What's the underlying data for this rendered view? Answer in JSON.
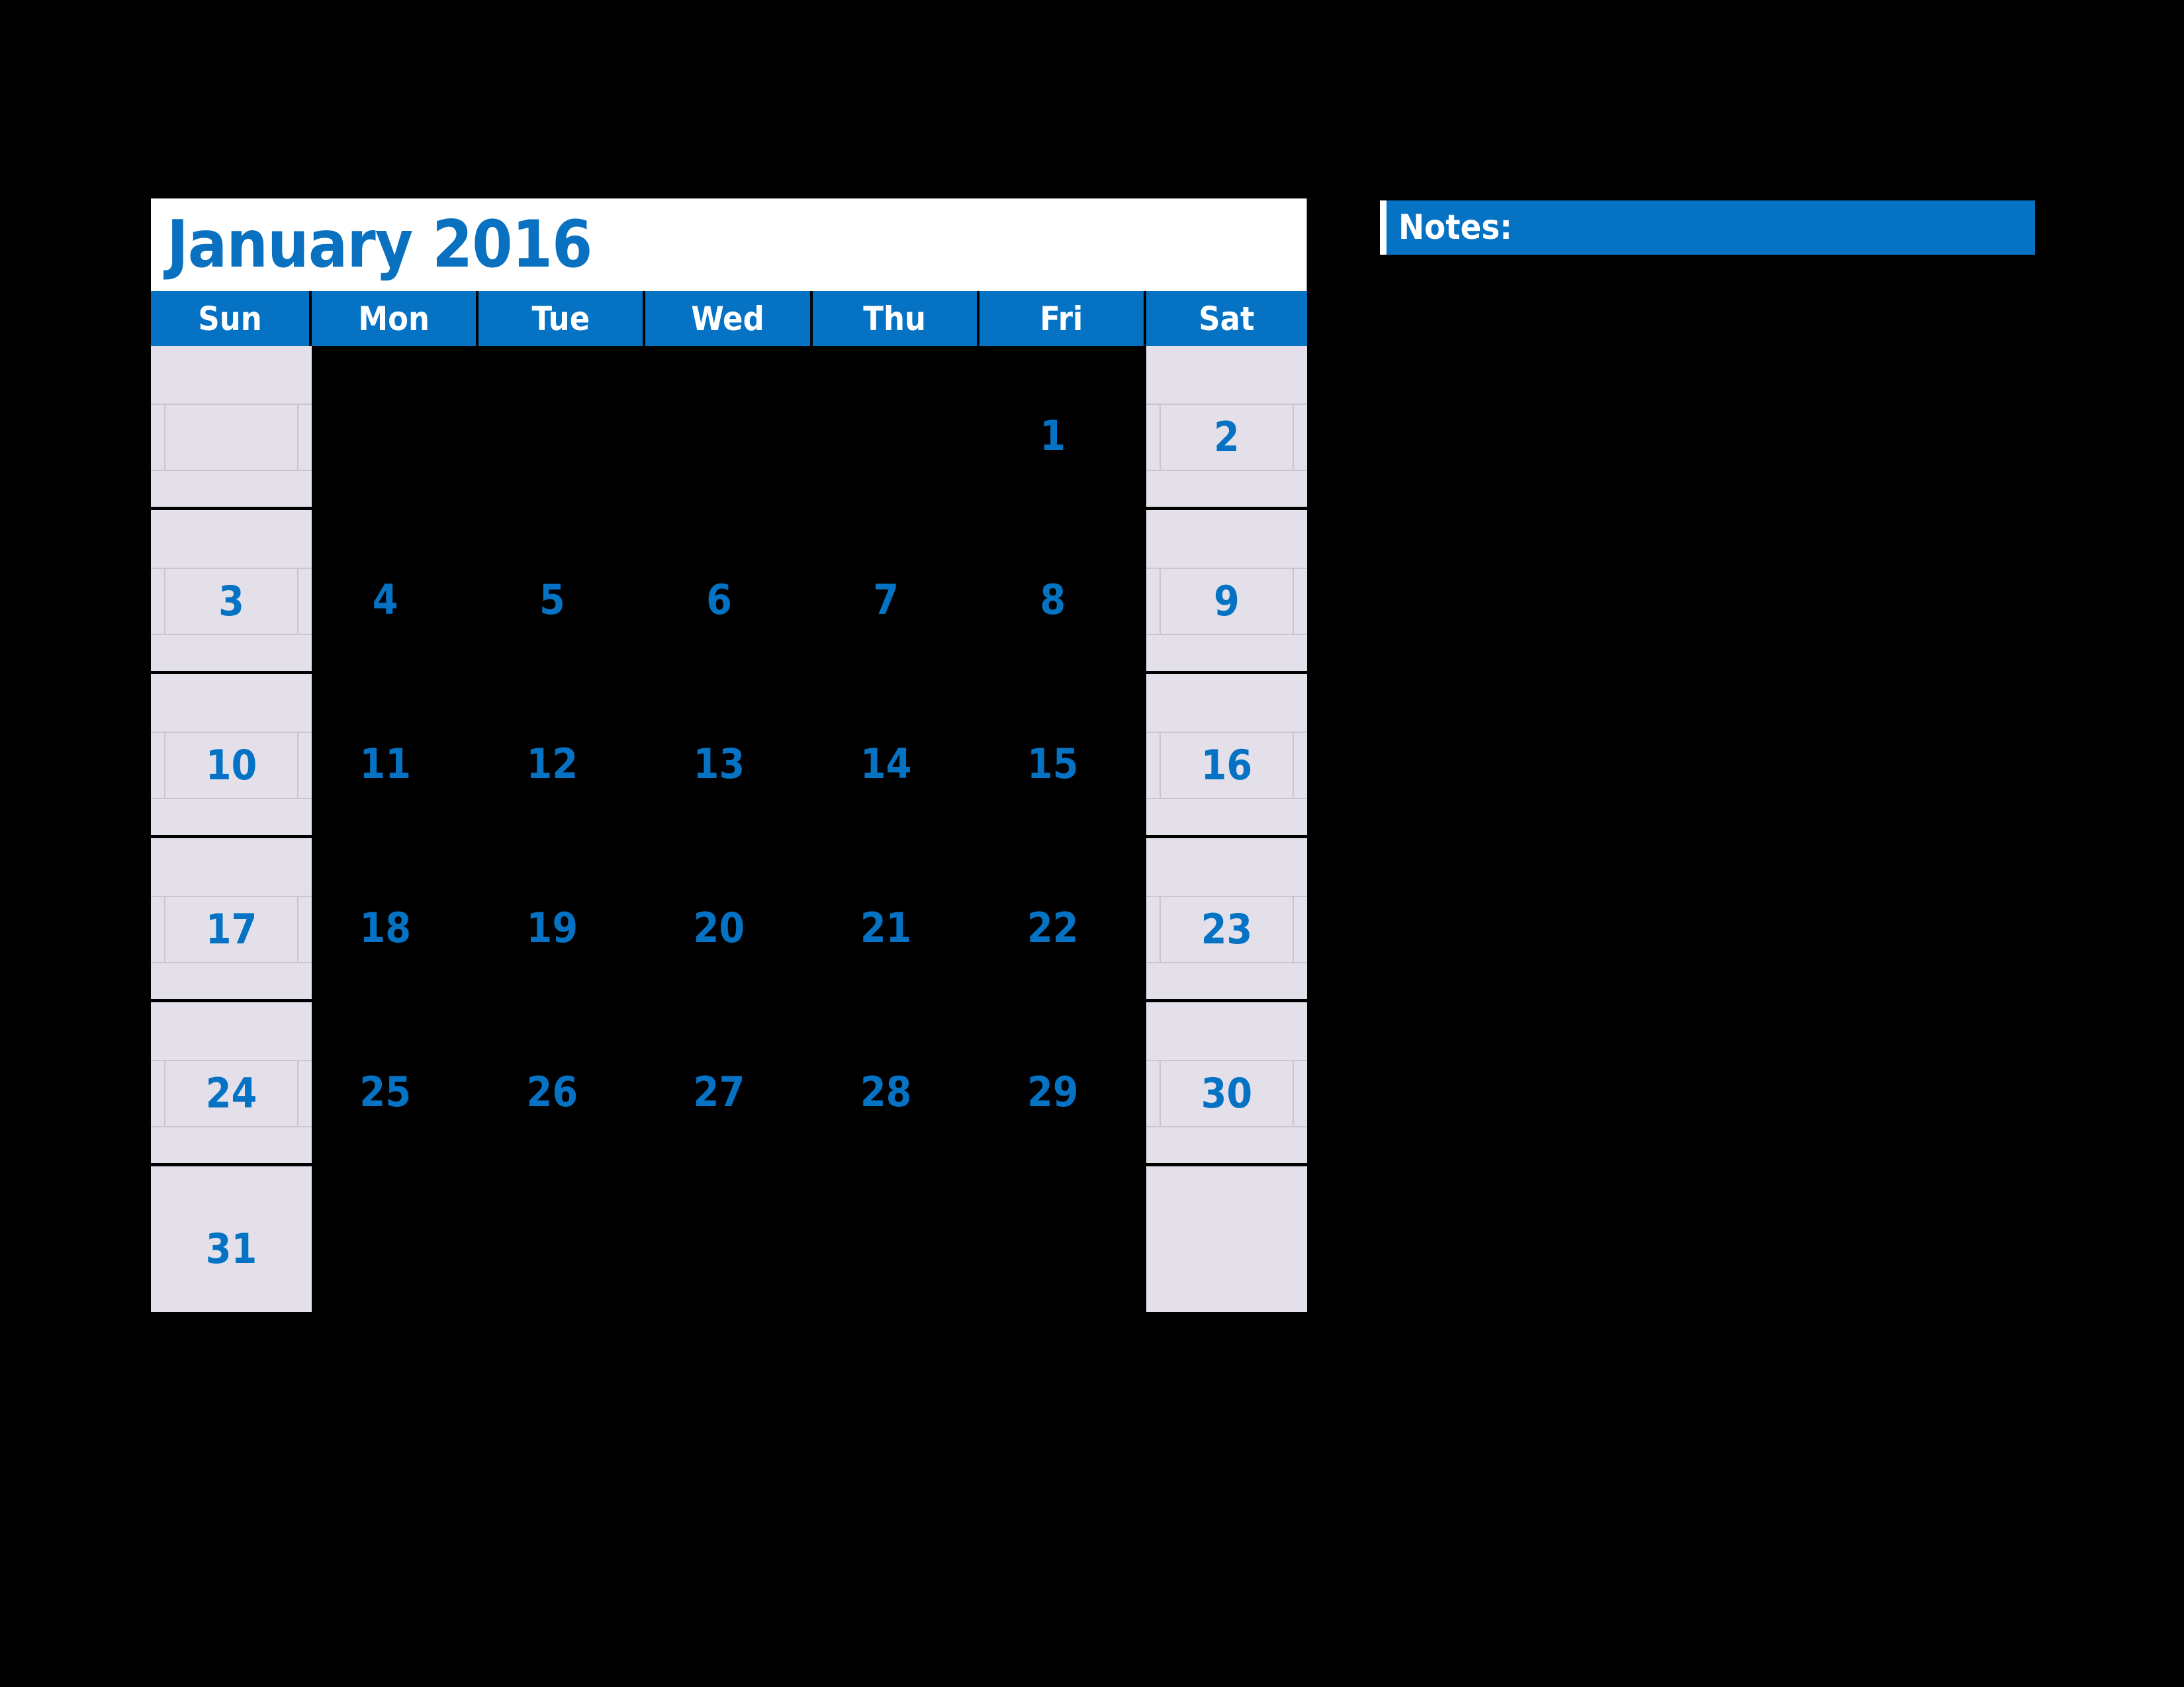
{
  "calendar": {
    "title": "January 2016",
    "month": "January",
    "year": "2016",
    "accent_color": "#0572c4",
    "weekend_cell_color": "#e3e0ea",
    "title_bar_color": "#ffffff",
    "page_background": "#000000",
    "day_headers": [
      {
        "label": "Sun",
        "type": "weekend"
      },
      {
        "label": "Mon",
        "type": "weekday"
      },
      {
        "label": "Tue",
        "type": "weekday"
      },
      {
        "label": "Wed",
        "type": "weekday"
      },
      {
        "label": "Thu",
        "type": "weekday"
      },
      {
        "label": "Fri",
        "type": "weekday"
      },
      {
        "label": "Sat",
        "type": "weekend"
      }
    ],
    "weeks": [
      {
        "days": [
          "",
          "",
          "",
          "",
          "",
          "1",
          "2"
        ]
      },
      {
        "days": [
          "3",
          "4",
          "5",
          "6",
          "7",
          "8",
          "9"
        ]
      },
      {
        "days": [
          "10",
          "11",
          "12",
          "13",
          "14",
          "15",
          "16"
        ]
      },
      {
        "days": [
          "17",
          "18",
          "19",
          "20",
          "21",
          "22",
          "23"
        ]
      },
      {
        "days": [
          "24",
          "25",
          "26",
          "27",
          "28",
          "29",
          "30"
        ]
      },
      {
        "days": [
          "31",
          "",
          "",
          "",
          "",
          "",
          ""
        ]
      }
    ]
  },
  "notes": {
    "label": "Notes:"
  }
}
